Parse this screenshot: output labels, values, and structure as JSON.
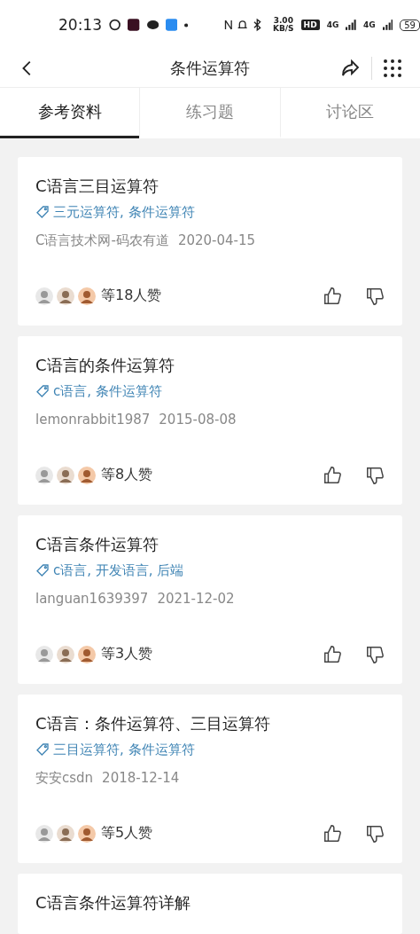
{
  "status_bar": {
    "time": "20:13",
    "speed": "3.00",
    "speed_unit": "KB/S",
    "hd": "HD",
    "network_1": "4G",
    "network_2": "4G",
    "battery": "59"
  },
  "header": {
    "title": "条件运算符"
  },
  "tabs": [
    {
      "label": "参考资料",
      "selected": true
    },
    {
      "label": "练习题",
      "selected": false
    },
    {
      "label": "讨论区",
      "selected": false
    }
  ],
  "cards": [
    {
      "title": "C语言三目运算符",
      "tags": "三元运算符, 条件运算符",
      "source": "C语言技术网-码农有道",
      "date": "2020-04-15",
      "likes": "等18人赞"
    },
    {
      "title": "C语言的条件运算符",
      "tags": "c语言, 条件运算符",
      "source": "lemonrabbit1987",
      "date": "2015-08-08",
      "likes": "等8人赞"
    },
    {
      "title": "C语言条件运算符",
      "tags": "c语言, 开发语言, 后端",
      "source": "languan1639397",
      "date": "2021-12-02",
      "likes": "等3人赞"
    },
    {
      "title": "C语言：条件运算符、三目运算符",
      "tags": "三目运算符, 条件运算符",
      "source": "安安csdn",
      "date": "2018-12-14",
      "likes": "等5人赞"
    },
    {
      "title": "C语言条件运算符详解"
    }
  ]
}
